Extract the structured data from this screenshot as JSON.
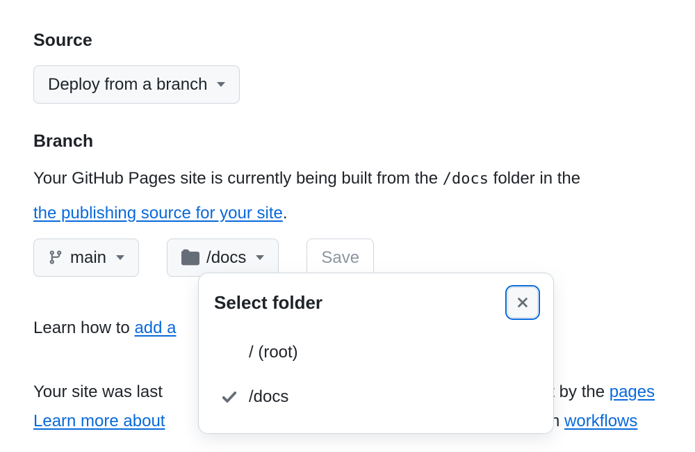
{
  "source": {
    "heading": "Source",
    "deploy_button_label": "Deploy from a branch"
  },
  "branch": {
    "heading": "Branch",
    "description_pre": "Your GitHub Pages site is currently being built from the ",
    "description_code": "/docs",
    "description_post": " folder in the ",
    "link_text": "the publishing source for your site",
    "period": ".",
    "branch_button_label": "main",
    "folder_button_label": "/docs",
    "save_button_label": "Save"
  },
  "popover": {
    "title": "Select folder",
    "options": [
      {
        "label": "/ (root)",
        "selected": false
      },
      {
        "label": "/docs",
        "selected": true
      }
    ]
  },
  "jekyll": {
    "pre": "Learn how to ",
    "link": "add a"
  },
  "deployment_info": {
    "line1_tail_pre": "nt by the ",
    "line1_link": "pages",
    "line2_pre": "Your site was last ",
    "line2_learn": "Learn more about ",
    "line2_tail_link_pre": "n ",
    "line2_tail_link": "workflows"
  }
}
